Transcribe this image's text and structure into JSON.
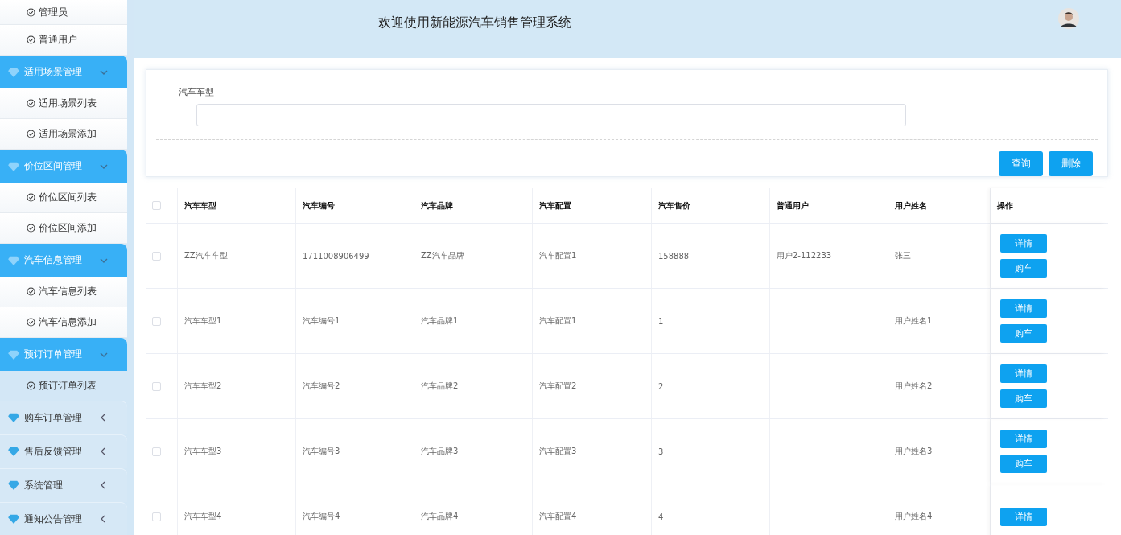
{
  "sidebar": {
    "groups": [
      {
        "children": [
          {
            "label": "管理员",
            "selected": false
          },
          {
            "label": "普通用户",
            "selected": false
          }
        ]
      },
      {
        "label": "适用场景管理",
        "expanded": true,
        "children": [
          {
            "label": "适用场景列表",
            "selected": false
          },
          {
            "label": "适用场景添加",
            "selected": false
          }
        ]
      },
      {
        "label": "价位区间管理",
        "expanded": true,
        "children": [
          {
            "label": "价位区间列表",
            "selected": false
          },
          {
            "label": "价位区间添加",
            "selected": false
          }
        ]
      },
      {
        "label": "汽车信息管理",
        "expanded": true,
        "children": [
          {
            "label": "汽车信息列表",
            "selected": false
          },
          {
            "label": "汽车信息添加",
            "selected": false
          }
        ]
      },
      {
        "label": "预订订单管理",
        "expanded": true,
        "children": [
          {
            "label": "预订订单列表",
            "selected": true
          }
        ]
      },
      {
        "label": "购车订单管理",
        "expanded": false
      },
      {
        "label": "售后反馈管理",
        "expanded": false
      },
      {
        "label": "系统管理",
        "expanded": false
      },
      {
        "label": "通知公告管理",
        "expanded": false
      }
    ]
  },
  "header": {
    "title": "欢迎使用新能源汽车销售管理系统"
  },
  "search": {
    "label": "汽车车型",
    "buttons": [
      "查询",
      "删除"
    ]
  },
  "table": {
    "all_selected": false,
    "columns": [
      "汽车车型",
      "汽车编号",
      "汽车品牌",
      "汽车配置",
      "汽车售价",
      "普通用户",
      "用户姓名",
      "操作"
    ],
    "rows": [
      {
        "selected": false,
        "cells": [
          "ZZ汽车车型",
          "1711008906499",
          "ZZ汽车品牌",
          "汽车配置1",
          "158888",
          "用户2-112233",
          "张三"
        ],
        "actions": [
          "详情",
          "购车"
        ]
      },
      {
        "selected": false,
        "cells": [
          "汽车车型1",
          "汽车编号1",
          "汽车品牌1",
          "汽车配置1",
          "1",
          null,
          "用户姓名1"
        ],
        "actions": [
          "详情",
          "购车"
        ]
      },
      {
        "selected": false,
        "cells": [
          "汽车车型2",
          "汽车编号2",
          "汽车品牌2",
          "汽车配置2",
          "2",
          null,
          "用户姓名2"
        ],
        "actions": [
          "详情",
          "购车"
        ]
      },
      {
        "selected": false,
        "cells": [
          "汽车车型3",
          "汽车编号3",
          "汽车品牌3",
          "汽车配置3",
          "3",
          null,
          "用户姓名3"
        ],
        "actions": [
          "详情",
          "购车"
        ]
      },
      {
        "selected": false,
        "cells": [
          "汽车车型4",
          "汽车编号4",
          "汽车品牌4",
          "汽车配置4",
          "4",
          null,
          "用户姓名4"
        ],
        "actions": [
          "详情"
        ]
      }
    ]
  }
}
